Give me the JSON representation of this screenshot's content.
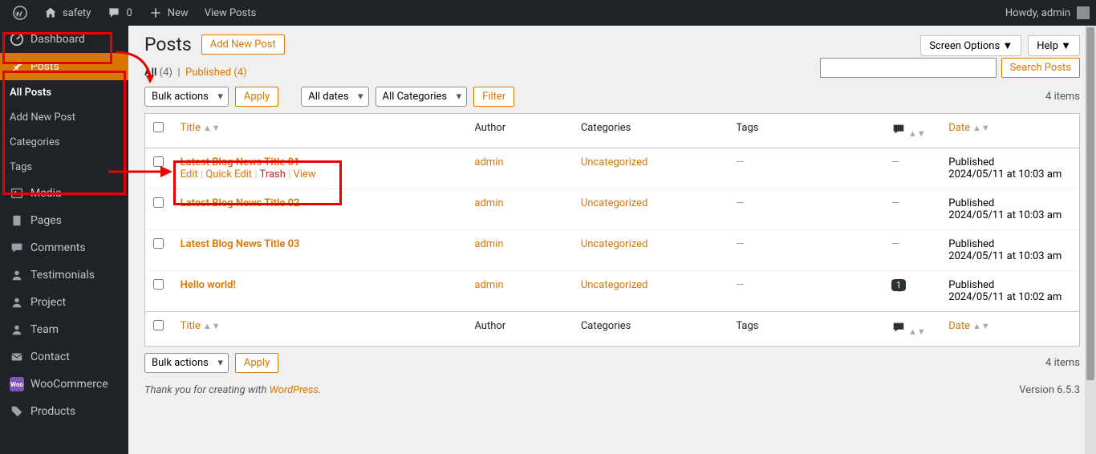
{
  "adminbar": {
    "site_name": "safety",
    "comments_count": "0",
    "new_label": "New",
    "view_posts": "View Posts",
    "howdy": "Howdy, admin"
  },
  "sidebar": {
    "dashboard": "Dashboard",
    "posts": "Posts",
    "all_posts": "All Posts",
    "add_new_post": "Add New Post",
    "categories": "Categories",
    "tags": "Tags",
    "media": "Media",
    "pages": "Pages",
    "comments": "Comments",
    "testimonials": "Testimonials",
    "project": "Project",
    "team": "Team",
    "contact": "Contact",
    "woocommerce": "WooCommerce",
    "products": "Products"
  },
  "header": {
    "page_title": "Posts",
    "add_new": "Add New Post",
    "screen_options": "Screen Options",
    "help": "Help"
  },
  "subsubsub": {
    "all_label": "All",
    "all_count": "(4)",
    "published_label": "Published",
    "published_count": "(4)"
  },
  "search": {
    "button": "Search Posts"
  },
  "filters": {
    "bulk_actions": "Bulk actions",
    "apply": "Apply",
    "all_dates": "All dates",
    "all_categories": "All Categories",
    "filter": "Filter",
    "item_count": "4 items"
  },
  "columns": {
    "title": "Title",
    "author": "Author",
    "categories": "Categories",
    "tags": "Tags",
    "date": "Date"
  },
  "row_actions": {
    "edit": "Edit",
    "quick_edit": "Quick Edit",
    "trash": "Trash",
    "view": "View"
  },
  "rows": [
    {
      "title": "Latest Blog News Title 01",
      "author": "admin",
      "category": "Uncategorized",
      "tags": "—",
      "comments": "—",
      "date_status": "Published",
      "date": "2024/05/11 at 10:03 am",
      "show_actions": true
    },
    {
      "title": "Latest Blog News Title 02",
      "author": "admin",
      "category": "Uncategorized",
      "tags": "—",
      "comments": "—",
      "date_status": "Published",
      "date": "2024/05/11 at 10:03 am"
    },
    {
      "title": "Latest Blog News Title 03",
      "author": "admin",
      "category": "Uncategorized",
      "tags": "—",
      "comments": "—",
      "date_status": "Published",
      "date": "2024/05/11 at 10:03 am"
    },
    {
      "title": "Hello world!",
      "author": "admin",
      "category": "Uncategorized",
      "tags": "—",
      "comments": "1",
      "date_status": "Published",
      "date": "2024/05/11 at 10:02 am",
      "comment_bubble": true
    }
  ],
  "footer": {
    "thanks_prefix": "Thank you for creating with ",
    "wordpress": "WordPress",
    "version": "Version 6.5.3"
  }
}
